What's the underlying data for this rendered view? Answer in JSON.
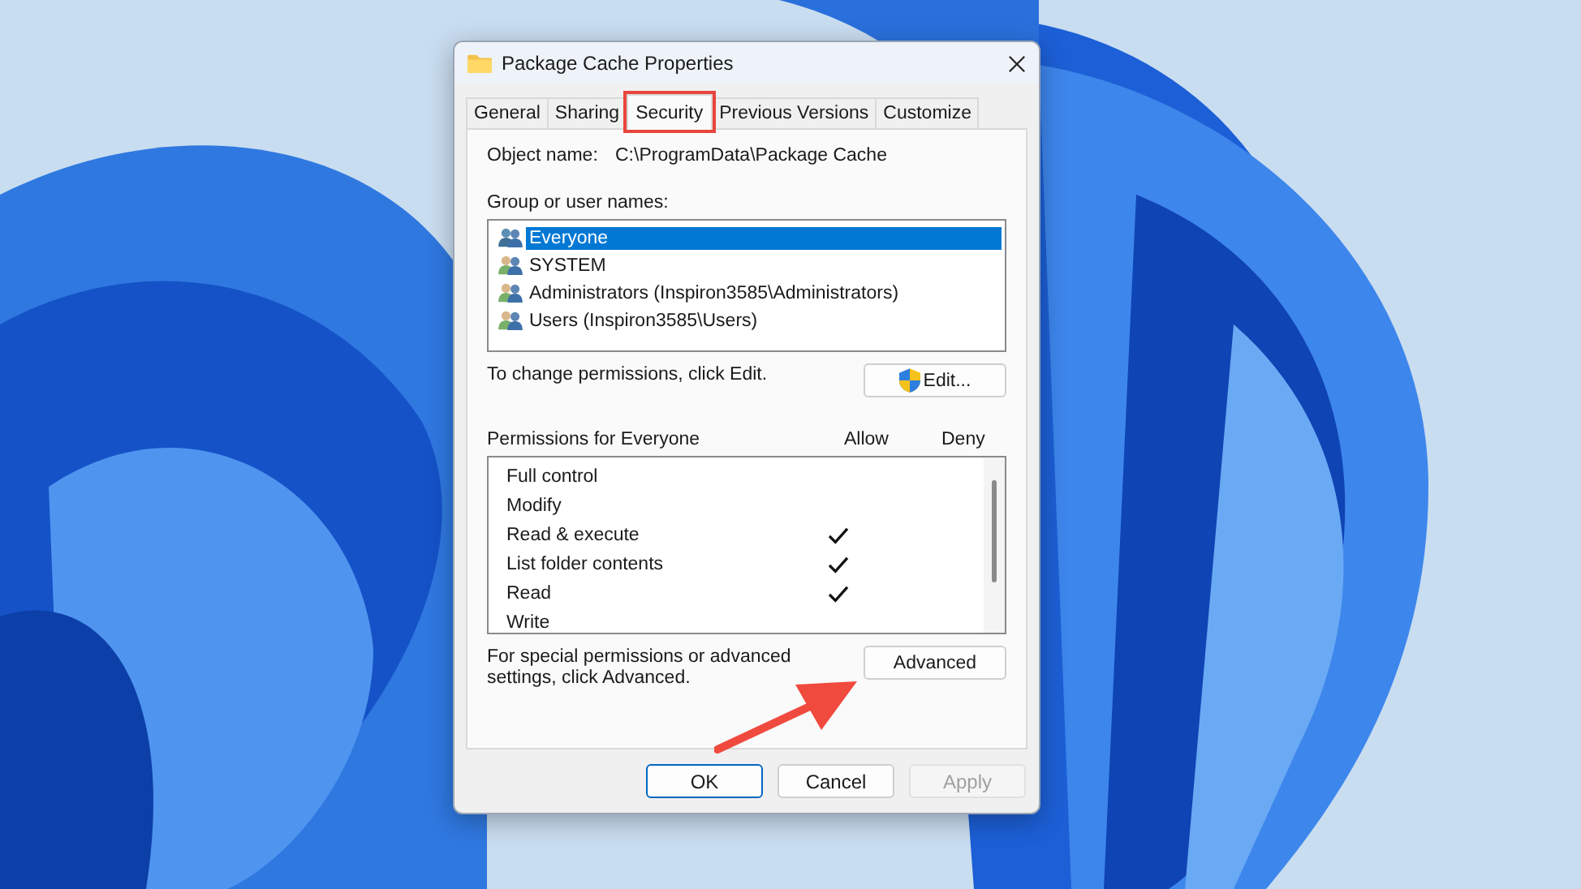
{
  "window": {
    "title": "Package Cache Properties"
  },
  "tabs": [
    {
      "label": "General",
      "selected": false,
      "highlighted": false
    },
    {
      "label": "Sharing",
      "selected": false,
      "highlighted": false
    },
    {
      "label": "Security",
      "selected": true,
      "highlighted": true
    },
    {
      "label": "Previous Versions",
      "selected": false,
      "highlighted": false
    },
    {
      "label": "Customize",
      "selected": false,
      "highlighted": false
    }
  ],
  "object_name": {
    "label": "Object name:",
    "value": "C:\\ProgramData\\Package Cache"
  },
  "users": {
    "label": "Group or user names:",
    "items": [
      {
        "name": "Everyone",
        "selected": true
      },
      {
        "name": "SYSTEM",
        "selected": false
      },
      {
        "name": "Administrators (Inspiron3585\\Administrators)",
        "selected": false
      },
      {
        "name": "Users (Inspiron3585\\Users)",
        "selected": false
      }
    ]
  },
  "edit_hint": "To change permissions, click Edit.",
  "edit_button": "Edit...",
  "permissions": {
    "label": "Permissions for Everyone",
    "allow_header": "Allow",
    "deny_header": "Deny",
    "rows": [
      {
        "name": "Full control",
        "allow": false,
        "deny": false
      },
      {
        "name": "Modify",
        "allow": false,
        "deny": false
      },
      {
        "name": "Read & execute",
        "allow": true,
        "deny": false
      },
      {
        "name": "List folder contents",
        "allow": true,
        "deny": false
      },
      {
        "name": "Read",
        "allow": true,
        "deny": false
      },
      {
        "name": "Write",
        "allow": false,
        "deny": false
      }
    ]
  },
  "advanced_hint": "For special permissions or advanced settings, click Advanced.",
  "advanced_button": "Advanced",
  "annotation": {
    "kind": "arrow"
  },
  "buttons": [
    {
      "label": "OK",
      "disabled": false,
      "default": true
    },
    {
      "label": "Cancel",
      "disabled": false,
      "default": false
    },
    {
      "label": "Apply",
      "disabled": true,
      "default": false
    }
  ]
}
